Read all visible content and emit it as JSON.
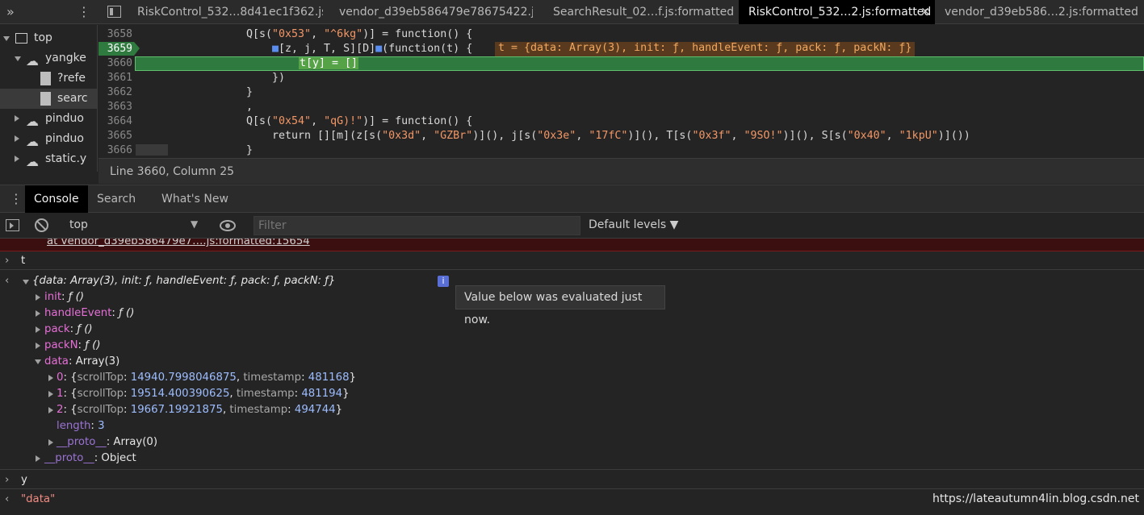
{
  "tabs": [
    {
      "label": "RiskControl_532…8d41ec1f362.js",
      "active": false
    },
    {
      "label": "vendor_d39eb586479e78675422.js",
      "active": false
    },
    {
      "label": "SearchResult_02…f.js:formatted",
      "active": false
    },
    {
      "label": "RiskControl_532…2.js:formatted",
      "active": true
    },
    {
      "label": "vendor_d39eb586…2.js:formatted",
      "active": false
    }
  ],
  "navigator": {
    "items": [
      "top",
      "yangke",
      "?refe",
      "searc",
      "pinduo",
      "pinduo",
      "static.y"
    ]
  },
  "editor": {
    "line_numbers": [
      "3658",
      "3659",
      "3660",
      "3661",
      "3662",
      "3663",
      "3664",
      "3665",
      "3666"
    ],
    "lines": {
      "l3658a": "Q[s(",
      "l3658b": "\"0x53\"",
      ", ": ", ",
      "l3658c": "\"^6kg\"",
      "l3658d": ")] = function() {",
      "l3659a": "[z, j, T, S][D]",
      "l3659b": "(function(t) {",
      "l3659_inline": "t = {data: Array(3), init: ƒ, handleEvent: ƒ, pack: ƒ, packN: ƒ}",
      "l3660": "t[y] = []",
      "l3661": "})",
      "l3662": "}",
      "l3663": ",",
      "l3664a": "Q[s(",
      "l3664b": "\"0x54\"",
      "l3664c": "\"qG)!\"",
      "l3664d": ")] = function() {",
      "l3665a": "return [][m](z[s(",
      "l3665b": "\"0x3d\"",
      "l3665c": "\"GZBr\"",
      "l3665d": ")](), j[s(",
      "l3665e": "\"0x3e\"",
      "l3665f": "\"17fC\"",
      "l3665g": ")](), T[s(",
      "l3665h": "\"0x3f\"",
      "l3665i": "\"9SO!\"",
      "l3665j": ")](), S[s(",
      "l3665k": "\"0x40\"",
      "l3665l": "\"1kpU\"",
      "l3665m": ")]())",
      "l3666": "}",
      "comma": ", "
    }
  },
  "status": {
    "position": "Line 3660, Column 25"
  },
  "drawer": {
    "tabs": [
      "Console",
      "Search",
      "What's New"
    ]
  },
  "console_toolbar": {
    "context": "top",
    "filter_placeholder": "Filter",
    "levels": "Default levels ▼"
  },
  "console": {
    "error_trace": "at vendor_d39eb586479e7….js:formatted:15654",
    "input1": "t",
    "summary": "{data: Array(3), init: ƒ, handleEvent: ƒ, pack: ƒ, packN: ƒ}",
    "info_badge": "i",
    "tooltip": "Value below was evaluated just now.",
    "props": [
      {
        "key": "init",
        "value": "ƒ ()"
      },
      {
        "key": "handleEvent",
        "value": "ƒ ()"
      },
      {
        "key": "pack",
        "value": "ƒ ()"
      },
      {
        "key": "packN",
        "value": "ƒ ()"
      }
    ],
    "data_key": "data",
    "data_val": "Array(3)",
    "items": [
      {
        "idx": "0",
        "scrollTop": "14940.7998046875",
        "timestamp": "481168"
      },
      {
        "idx": "1",
        "scrollTop": "19514.400390625",
        "timestamp": "481194"
      },
      {
        "idx": "2",
        "scrollTop": "19667.19921875",
        "timestamp": "494744"
      }
    ],
    "k_scrollTop": "scrollTop",
    "k_timestamp": "timestamp",
    "length_key": "length",
    "length_val": "3",
    "proto_key": "__proto__",
    "proto_arr": "Array(0)",
    "proto_obj": "Object",
    "input2": "y",
    "result2": "\"data\"",
    "watermark": "https://lateautumn4lin.blog.csdn.net"
  },
  "colors": {
    "accent_green": "#2f7a3f",
    "error_bg": "#3b0f10",
    "key_color": "#e66fd7",
    "num_color": "#9dbdff"
  }
}
